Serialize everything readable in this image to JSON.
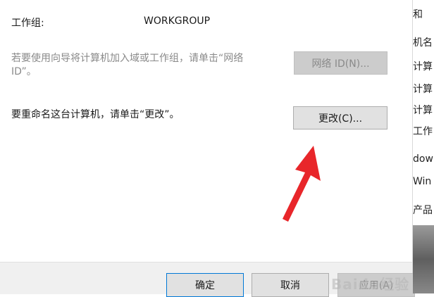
{
  "workgroup": {
    "label": "工作组:",
    "value": "WORKGROUP"
  },
  "network_id": {
    "hint": "若要使用向导将计算机加入域或工作组，请单击“网络ID”。",
    "button_label": "网络 ID(N)..."
  },
  "rename": {
    "text": "要重命名这台计算机，请单击“更改”。",
    "button_label": "更改(C)..."
  },
  "footer": {
    "ok_label": "确定",
    "cancel_label": "取消",
    "apply_label": "应用(A)"
  },
  "side_panel": {
    "items": [
      "些和",
      "机名",
      "计算",
      "计算",
      "计算",
      "工作",
      "dow",
      "Win",
      "产品"
    ]
  },
  "watermark": "Baidu经验",
  "colors": {
    "annotation_arrow": "#e8262a",
    "primary_button_border": "#0078d7"
  }
}
